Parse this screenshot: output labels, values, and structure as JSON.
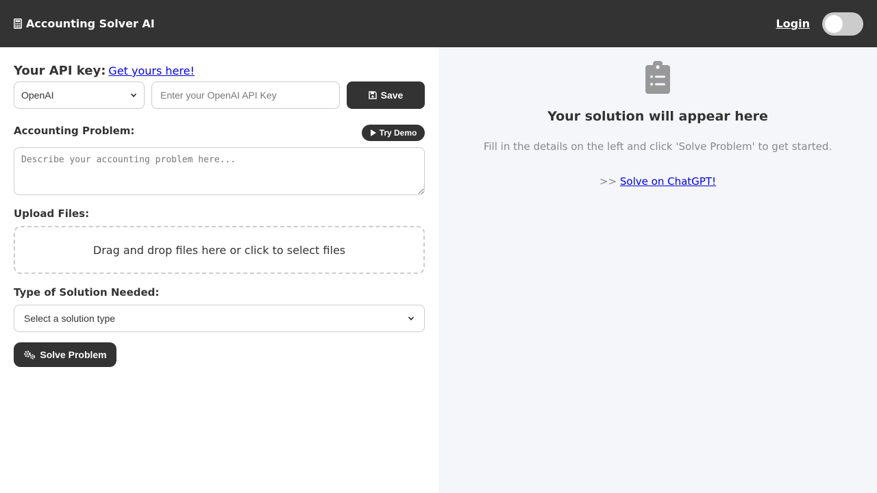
{
  "header": {
    "brand_icon": "calculator-icon",
    "title": "Accounting Solver AI",
    "login_label": "Login",
    "theme_toggle": "off"
  },
  "api": {
    "label": "Your API key:",
    "link": "Get yours here!",
    "provider_selected": "OpenAI",
    "input_placeholder": "Enter your OpenAI API Key",
    "input_value": "",
    "save_label": "Save"
  },
  "problem": {
    "label": "Accounting Problem:",
    "demo_label": "Try Demo",
    "placeholder": "Describe your accounting problem here..."
  },
  "upload": {
    "label": "Upload Files:",
    "dropzone_text": "Drag and drop files here or click to select files"
  },
  "solution_type": {
    "label": "Type of Solution Needed:",
    "selected": "Select a solution type"
  },
  "solve_label": "Solve Problem",
  "result": {
    "title": "Your solution will appear here",
    "description": "Fill in the details on the left and click 'Solve Problem' to get started.",
    "prefix": ">>",
    "chatgpt_link": "Solve on ChatGPT!"
  },
  "colors": {
    "header_bg": "#333333",
    "right_panel_bg": "#f5f6fa",
    "link": "#0000ee",
    "button_bg": "#333333"
  }
}
